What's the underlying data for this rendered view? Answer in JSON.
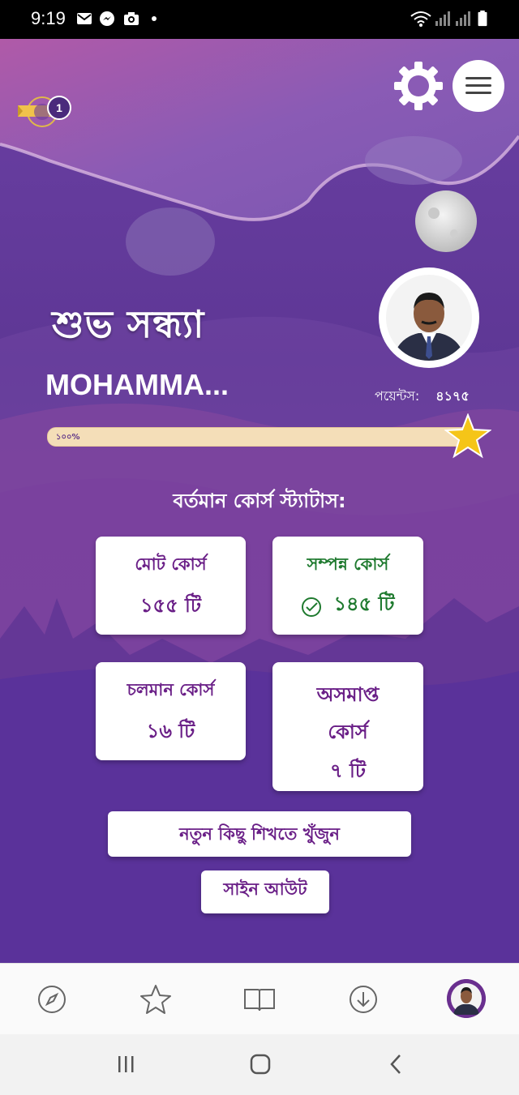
{
  "status_bar": {
    "time": "9:19"
  },
  "header": {
    "badge_count": "1"
  },
  "greeting": "শুভ সন্ধ্যা",
  "user": {
    "name": "MOHAMMA...",
    "points_label": "পয়েন্টস:",
    "points_value": "৪১৭৫"
  },
  "progress": {
    "label": "১০০%",
    "value_percent": 100
  },
  "section_title": "বর্তমান কোর্স স্ট্যাটাস:",
  "cards": {
    "total": {
      "title": "মোট কোর্স",
      "value": "১৫৫ টি"
    },
    "completed": {
      "title": "সম্পন্ন কোর্স",
      "value": "১৪৫ টি"
    },
    "ongoing": {
      "title": "চলমান কোর্স",
      "value": "১৬ টি"
    },
    "incomplete": {
      "title_line1": "অসমাপ্ত",
      "title_line2": "কোর্স",
      "value": "৭ টি"
    }
  },
  "buttons": {
    "find_new": "নতুন কিছু শিখতে খুঁজুন",
    "sign_out": "সাইন আউট"
  },
  "bottom_nav": {
    "items": [
      {
        "icon": "compass-icon"
      },
      {
        "icon": "star-icon"
      },
      {
        "icon": "book-icon"
      },
      {
        "icon": "download-icon"
      },
      {
        "icon": "profile-avatar"
      }
    ]
  },
  "colors": {
    "accent": "#6a1f87",
    "success": "#1f7a2f",
    "background": "#5e3795",
    "star": "#f5c518"
  }
}
